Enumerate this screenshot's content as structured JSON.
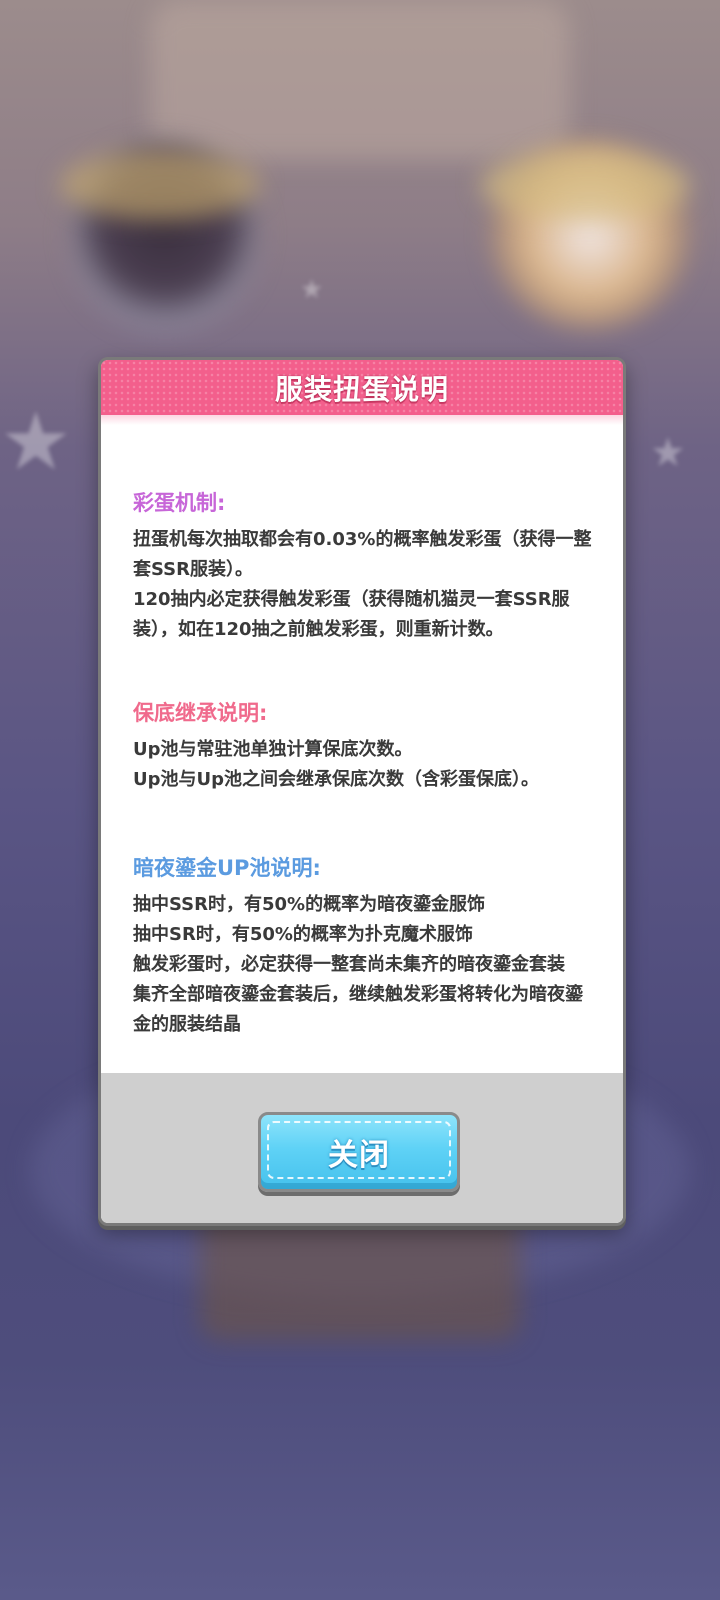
{
  "dialog": {
    "title": "服装扭蛋说明",
    "sections": [
      {
        "title": "彩蛋机制:",
        "color": "#c766d8",
        "lines": [
          "扭蛋机每次抽取都会有0.03%的概率触发彩蛋（获得一整套SSR服装）。",
          "120抽内必定获得触发彩蛋（获得随机猫灵一套SSR服装），如在120抽之前触发彩蛋，则重新计数。"
        ]
      },
      {
        "title": "保底继承说明:",
        "color": "#f06a8c",
        "lines": [
          "Up池与常驻池单独计算保底次数。",
          "Up池与Up池之间会继承保底次数（含彩蛋保底）。"
        ]
      },
      {
        "title": "暗夜鎏金UP池说明:",
        "color": "#5b9be0",
        "lines": [
          "抽中SSR时，有50%的概率为暗夜鎏金服饰",
          "抽中SR时，有50%的概率为扑克魔术服饰",
          "触发彩蛋时，必定获得一整套尚未集齐的暗夜鎏金套装",
          "集齐全部暗夜鎏金套装后，继续触发彩蛋将转化为暗夜鎏金的服装结晶"
        ]
      }
    ],
    "close_label": "关闭"
  },
  "colors": {
    "header": "#f35f8c",
    "button": "#5fd2f6",
    "footer": "#cfcfcf"
  }
}
